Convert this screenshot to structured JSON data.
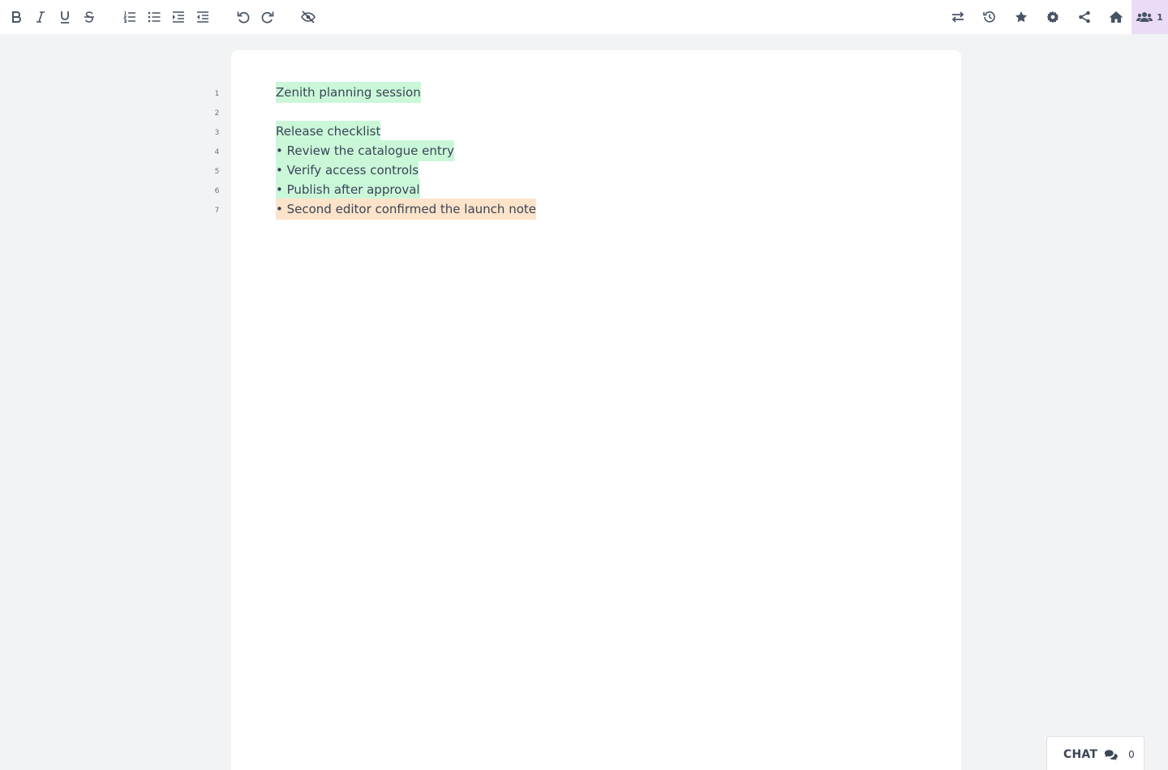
{
  "toolbar": {
    "left_buttons": [
      {
        "name": "bold-button",
        "glyph": "B",
        "icon": "bold-icon"
      },
      {
        "name": "italic-button",
        "glyph": "I",
        "icon": "italic-icon"
      },
      {
        "name": "underline-button",
        "glyph": "U",
        "icon": "underline-icon"
      },
      {
        "name": "strikethrough-button",
        "glyph": "S",
        "icon": "strikethrough-icon"
      }
    ],
    "users_count": "1"
  },
  "line_numbers": [
    "1",
    "2",
    "3",
    "4",
    "5",
    "6",
    "7"
  ],
  "document": {
    "lines": [
      {
        "text": "Zenith planning session",
        "author_color": "green"
      },
      {
        "text": "",
        "author_color": "none"
      },
      {
        "text": "Release checklist",
        "author_color": "green"
      },
      {
        "text": "• Review the catalogue entry",
        "author_color": "green"
      },
      {
        "text": "• Verify access controls",
        "author_color": "green"
      },
      {
        "text": "• Publish after approval",
        "author_color": "green"
      },
      {
        "text": "• Second editor confirmed the launch note",
        "author_color": "orange"
      }
    ]
  },
  "author_colors": {
    "green": "#cbf7d9",
    "orange": "#fce3c9"
  },
  "chat": {
    "label": "CHAT",
    "count": "0"
  }
}
